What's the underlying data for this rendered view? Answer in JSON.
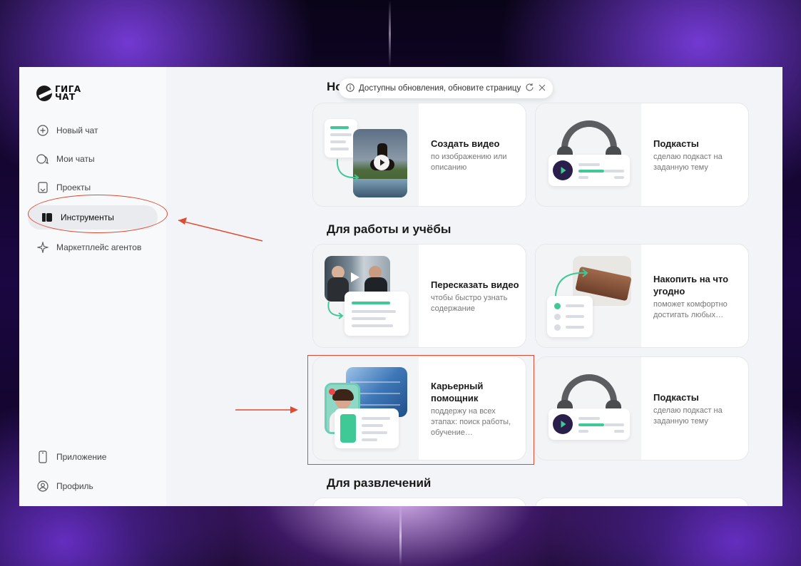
{
  "logo": {
    "line1": "ГИГА",
    "line2": "ЧАТ"
  },
  "sidebar": {
    "items": [
      {
        "label": "Новый чат",
        "icon": "plus-circle-icon"
      },
      {
        "label": "Мои чаты",
        "icon": "chat-bubbles-icon"
      },
      {
        "label": "Проекты",
        "icon": "folder-icon"
      },
      {
        "label": "Инструменты",
        "icon": "tools-icon",
        "active": true
      },
      {
        "label": "Маркетплейс агентов",
        "icon": "sparkle-icon"
      }
    ],
    "bottom": [
      {
        "label": "Приложение",
        "icon": "phone-icon"
      },
      {
        "label": "Профиль",
        "icon": "profile-icon"
      }
    ]
  },
  "toast": {
    "text": "Доступны обновления, обновите страницу"
  },
  "sections": {
    "new_partial": "Но",
    "work": "Для работы и учёбы",
    "fun": "Для развлечений"
  },
  "cards": {
    "video": {
      "title": "Создать видео",
      "desc": "по изображению или описанию"
    },
    "podcast1": {
      "title": "Подкасты",
      "desc": "сделаю подкаст на заданную тему"
    },
    "retell": {
      "title": "Пересказать видео",
      "desc": "чтобы быстро узнать содержание"
    },
    "save": {
      "title": "Накопить на что угодно",
      "desc": "поможет комфортно достигать любых…"
    },
    "career": {
      "title": "Карьерный помощник",
      "desc": "поддержу на всех этапах: поиск работы, обучение…"
    },
    "podcast2": {
      "title": "Подкасты",
      "desc": "сделаю подкаст на заданную тему"
    }
  },
  "colors": {
    "accent_green": "#3fc996",
    "annotation_red": "#e04a30",
    "dark": "#1a1a1a"
  }
}
